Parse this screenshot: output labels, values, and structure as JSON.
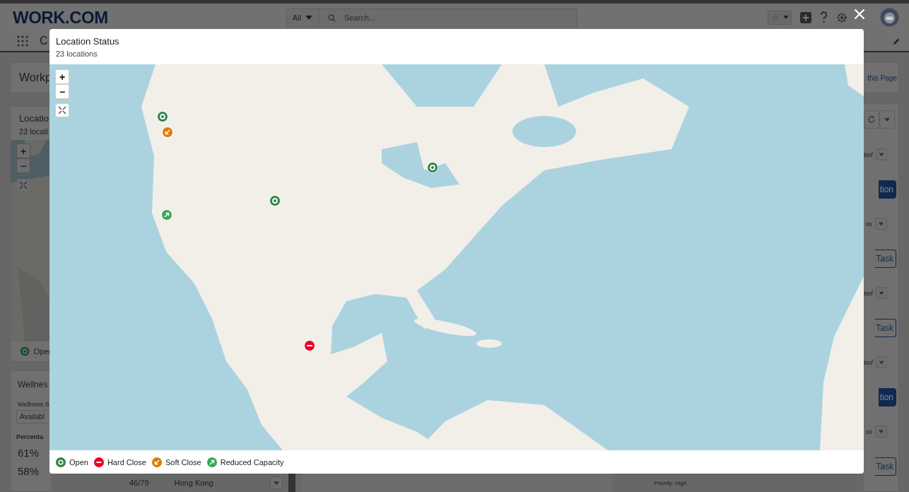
{
  "header": {
    "logo": "WORK.COM",
    "scope": "All",
    "search": {
      "placeholder": "Search..."
    }
  },
  "nav": {
    "app_name": "C"
  },
  "left_panel": {
    "page_title": "Workp",
    "location_card": {
      "title": "Locatio",
      "subtitle": "23 locati",
      "zoom_in": "+",
      "zoom_out": "−",
      "legend_label": "Oper"
    },
    "wellness_card": {
      "title": "Wellnes",
      "filter_label": "Wellness S",
      "filter_value": "Availabl",
      "column_1": "Percenta",
      "rows": [
        "61%",
        "58%"
      ]
    }
  },
  "background_row": {
    "cells": [
      "46/79",
      "Hong Kong"
    ],
    "detail": "Priority: High"
  },
  "right_panel": {
    "link": "this Page",
    "rows": [
      {
        "status": "ted",
        "action": "tion",
        "kind": "primary"
      },
      {
        "status": "ss",
        "action": "Task",
        "kind": "outline"
      },
      {
        "status": "ted",
        "action": "Task",
        "kind": "outline"
      },
      {
        "status": "ted",
        "action": "tion",
        "kind": "primary"
      },
      {
        "status": "ss",
        "action": "Task",
        "kind": "outline"
      }
    ]
  },
  "modal": {
    "title": "Location Status",
    "subtitle": "23 locations",
    "zoom_in": "+",
    "zoom_out": "−",
    "markers": [
      {
        "kind": "open"
      },
      {
        "kind": "soft_close"
      },
      {
        "kind": "reduced"
      },
      {
        "kind": "open"
      },
      {
        "kind": "open"
      },
      {
        "kind": "hard_close"
      }
    ],
    "legend": [
      {
        "kind": "open",
        "label": "Open",
        "color": "#2e844a"
      },
      {
        "kind": "hard_close",
        "label": "Hard Close",
        "color": "#ea001e"
      },
      {
        "kind": "soft_close",
        "label": "Soft Close",
        "color": "#dd7a01"
      },
      {
        "kind": "reduced",
        "label": "Reduced Capacity",
        "color": "#3ba755"
      }
    ]
  }
}
